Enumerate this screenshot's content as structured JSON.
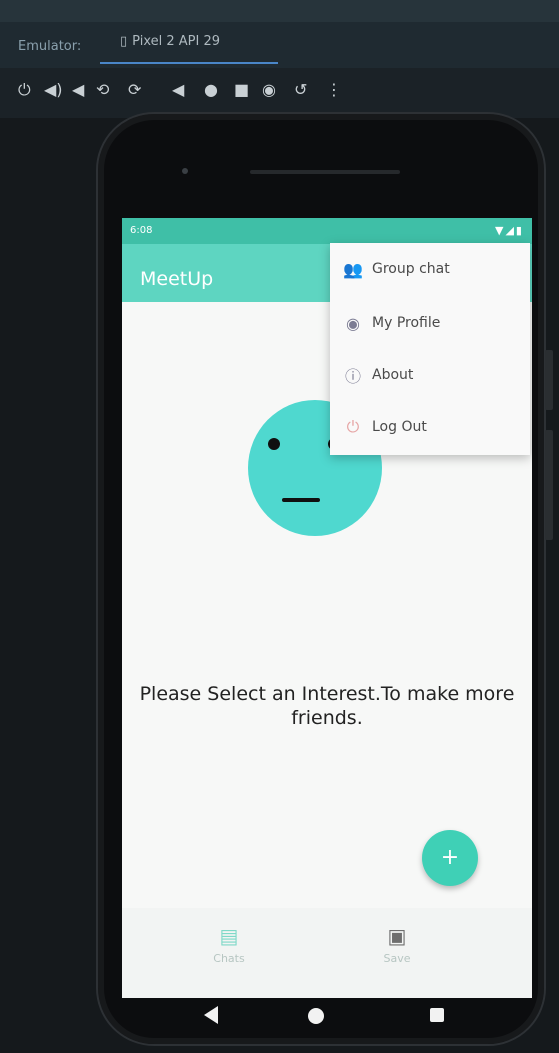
{
  "emulator": {
    "label": "Emulator:",
    "tab_name": "Pixel 2 API 29",
    "toolbar_icons": [
      "power-icon",
      "volume-up-icon",
      "volume-down-icon",
      "rotate-left-icon",
      "rotate-right-icon",
      "back-icon",
      "home-icon",
      "overview-icon",
      "camera-icon",
      "history-icon",
      "more-icon"
    ]
  },
  "status_bar": {
    "time": "6:08",
    "icons": "▼◢▮"
  },
  "app": {
    "title": "MeetUp"
  },
  "menu": {
    "items": [
      {
        "label": "Group chat",
        "icon": "group-icon"
      },
      {
        "label": "My Profile",
        "icon": "profile-icon"
      },
      {
        "label": "About",
        "icon": "info-icon"
      },
      {
        "label": "Log Out",
        "icon": "power-icon"
      }
    ]
  },
  "main": {
    "message": "Please Select an Interest.To make more friends."
  },
  "fab": {
    "label": "+"
  },
  "bottom_nav": {
    "items": [
      {
        "label": "Chats",
        "icon": "chat-icon"
      },
      {
        "label": "Save",
        "icon": "gallery-icon"
      }
    ]
  },
  "colors": {
    "status_bar": "#3fbfa7",
    "app_bar": "#5ed5c1",
    "face": "#4fd8cf",
    "fab": "#3fd0b6"
  }
}
